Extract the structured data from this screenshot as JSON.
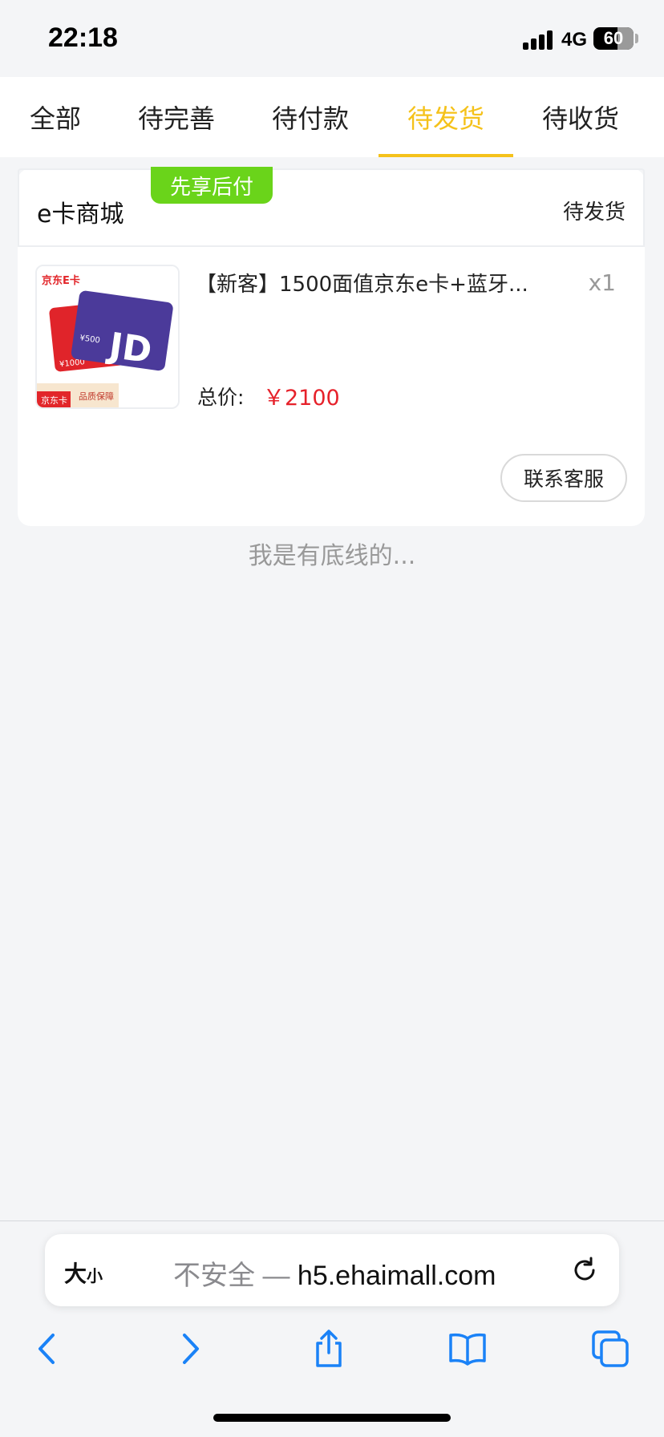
{
  "status_bar": {
    "time": "22:18",
    "network": "4G",
    "battery": "60",
    "battery_level": 0.6
  },
  "tabs": [
    {
      "label": "全部",
      "active": false
    },
    {
      "label": "待完善",
      "active": false
    },
    {
      "label": "待付款",
      "active": false
    },
    {
      "label": "待发货",
      "active": true
    },
    {
      "label": "待收货",
      "active": false
    }
  ],
  "order": {
    "store_name": "e卡商城",
    "badge": "先享后付",
    "status": "待发货",
    "thumbnail": {
      "brand_label": "京东E卡",
      "card_value_front": "¥500",
      "card_value_back": "¥1000",
      "logo": "JD",
      "footer_left": "京东卡",
      "footer_right": "品质保障"
    },
    "product_title": "【新客】1500面值京东e卡+蓝牙...",
    "quantity": "x1",
    "total_label": "总价:",
    "total_value": "￥2100",
    "contact_button": "联系客服"
  },
  "footer_text": "我是有底线的...",
  "browser": {
    "text_size_big": "大",
    "text_size_small": "小",
    "url_prefix": "不安全 — ",
    "url_domain": "h5.ehaimall.com"
  },
  "icons": {
    "back": "chevron-left-icon",
    "forward": "chevron-right-icon",
    "share": "share-icon",
    "bookmarks": "book-icon",
    "tabs": "tabs-icon",
    "reload": "reload-icon"
  },
  "colors": {
    "accent": "#f5c21b",
    "badge": "#6ad41a",
    "price": "#e6212a",
    "ios_blue": "#1a82f7"
  }
}
